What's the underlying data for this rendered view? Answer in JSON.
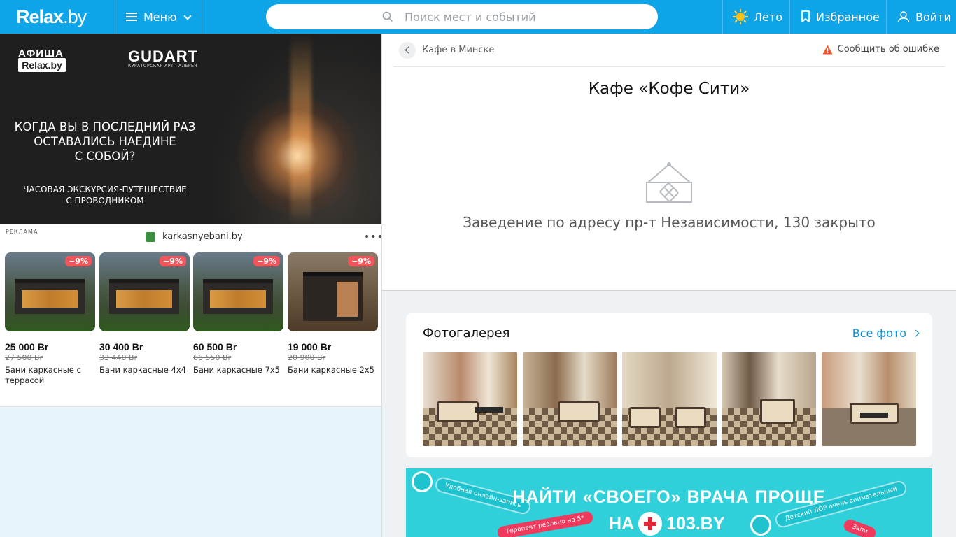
{
  "header": {
    "logo": "Relax",
    "logo_suffix": ".by",
    "menu_label": "Меню",
    "search_placeholder": "Поиск мест и событий",
    "season_label": "Лето",
    "favorites_label": "Избранное",
    "login_label": "Войти"
  },
  "banner": {
    "afisha": "АФИША",
    "afisha_brand": "Relax.by",
    "partner": "GUDART",
    "partner_sub": "КУРАТОРСКАЯ АРТ-ГАЛЕРЕЯ",
    "question_lines": [
      "КОГДА ВЫ В ПОСЛЕДНИЙ РАЗ",
      "ОСТАВАЛИСЬ НАЕДИНЕ",
      "С СОБОЙ?"
    ],
    "sub_lines": [
      "ЧАСОВАЯ ЭКСКУРСИЯ-ПУТЕШЕСТВИЕ",
      "С ПРОВОДНИКОМ"
    ]
  },
  "ad": {
    "label": "РЕКЛАМА",
    "domain": "karkasnyebani.by",
    "more": "•••",
    "items": [
      {
        "discount": "−9%",
        "price": "25 000 Br",
        "old_price": "27 500 Br",
        "title": "Бани каркасные с террасой"
      },
      {
        "discount": "−9%",
        "price": "30 400 Br",
        "old_price": "33 440 Br",
        "title": "Бани каркасные 4х4"
      },
      {
        "discount": "−9%",
        "price": "60 500 Br",
        "old_price": "66 550 Br",
        "title": "Бани каркасные 7х5"
      },
      {
        "discount": "−9%",
        "price": "19 000 Br",
        "old_price": "20 900 Br",
        "title": "Бани каркасные 2х5"
      }
    ]
  },
  "place": {
    "breadcrumb": "Кафе в Минске",
    "report_label": "Сообщить об ошибке",
    "title": "Кафе «Кофе Сити»",
    "closed_text": "Заведение по адресу пр-т Независимости, 130 закрыто"
  },
  "gallery": {
    "title": "Фотогалерея",
    "all_label": "Все фото",
    "photo_count": 5
  },
  "ad_103": {
    "headline": "НАЙТИ «СВОЕГО» ВРАЧА ПРОЩЕ",
    "headline_pre": "НА",
    "brand": "103.BY",
    "pills": [
      "Удобная онлайн-запись",
      "Терапевт реально на 5*",
      "Детский ЛОР очень внимательный",
      "Запи"
    ]
  },
  "colors": {
    "brand_blue": "#0da5e8",
    "link_blue": "#0d8ed6",
    "discount_red": "#f2545b",
    "ad_cyan": "#2fd0da"
  }
}
